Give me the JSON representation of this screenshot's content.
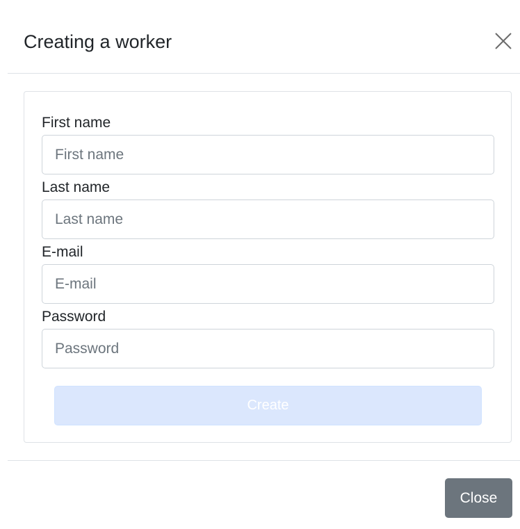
{
  "modal": {
    "title": "Creating a worker",
    "close_icon": "close-icon"
  },
  "form": {
    "first_name": {
      "label": "First name",
      "placeholder": "First name",
      "value": ""
    },
    "last_name": {
      "label": "Last name",
      "placeholder": "Last name",
      "value": ""
    },
    "email": {
      "label": "E-mail",
      "placeholder": "E-mail",
      "value": ""
    },
    "password": {
      "label": "Password",
      "placeholder": "Password",
      "value": ""
    },
    "submit_label": "Create",
    "submit_disabled": true
  },
  "footer": {
    "close_label": "Close"
  },
  "colors": {
    "submit_disabled_bg": "#dbe7fd",
    "close_button_bg": "#6c757d",
    "border": "#dee2e6"
  }
}
